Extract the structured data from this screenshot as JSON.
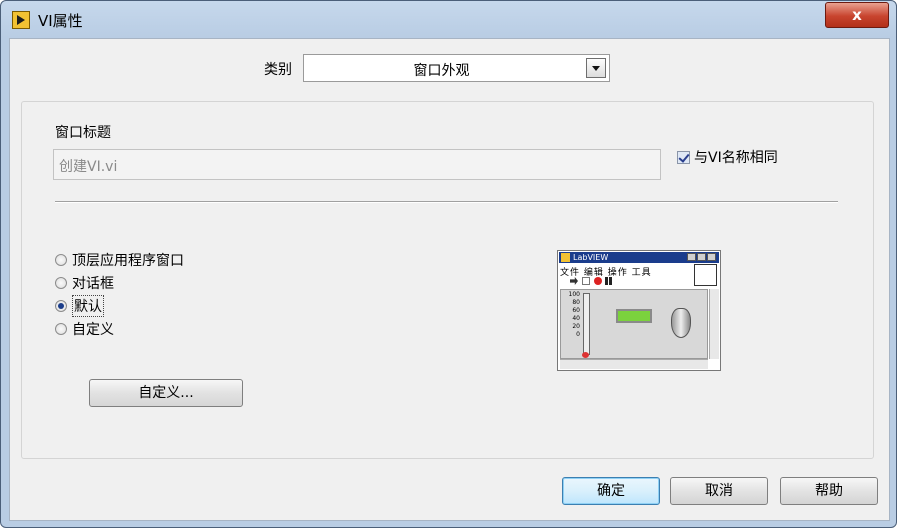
{
  "window": {
    "title": "VI属性",
    "close_label": "x"
  },
  "category": {
    "label": "类别",
    "value": "窗口外观"
  },
  "window_title_section": {
    "label": "窗口标题",
    "input_value": "创建VI.vi",
    "same_as_vi_label": "与VI名称相同",
    "same_as_vi_checked": true
  },
  "appearance_options": [
    {
      "label": "顶层应用程序窗口",
      "checked": false
    },
    {
      "label": "对话框",
      "checked": false
    },
    {
      "label": "默认",
      "checked": true
    },
    {
      "label": "自定义",
      "checked": false
    }
  ],
  "custom_button_label": "自定义...",
  "preview": {
    "title": "LabVIEW",
    "menu": "文件 编辑 操作 工具",
    "scale": [
      "100",
      "80",
      "60",
      "40",
      "20",
      "0"
    ]
  },
  "buttons": {
    "ok": "确定",
    "cancel": "取消",
    "help": "帮助"
  },
  "colors": {
    "titlebar": "#b9cde4",
    "close": "#c8442e",
    "dialog_bg": "#f0f0f0",
    "default_button": "#d9f0fc"
  }
}
